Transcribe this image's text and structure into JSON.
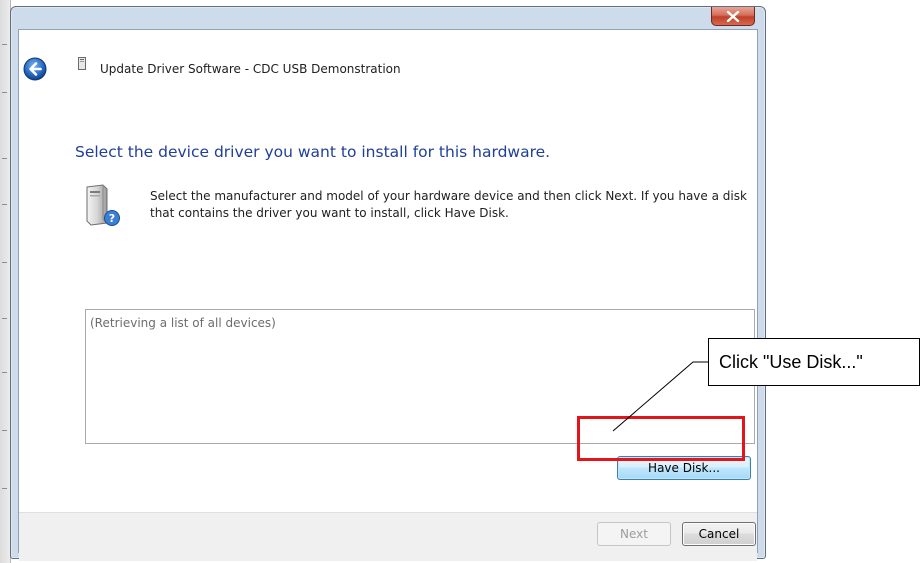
{
  "window": {
    "title": "Update Driver Software - CDC USB Demonstration",
    "close_symbol": "x"
  },
  "page": {
    "heading": "Select the device driver you want to install for this hardware.",
    "instructions": "Select the manufacturer and model of your hardware device and then click Next. If you have a disk that contains the driver you want to install, click Have Disk.",
    "icon": "hardware-device-question-icon"
  },
  "device_list": {
    "status_text": "(Retrieving a list of all devices)"
  },
  "buttons": {
    "have_disk": "Have Disk...",
    "next": "Next",
    "cancel": "Cancel"
  },
  "annotation": {
    "callout_text": "Click \"Use Disk...\"",
    "highlight_color": "#e3151b"
  },
  "colors": {
    "heading": "#1f3f9a",
    "back_button": "#1f5fb0",
    "close_button": "#c0402a"
  }
}
